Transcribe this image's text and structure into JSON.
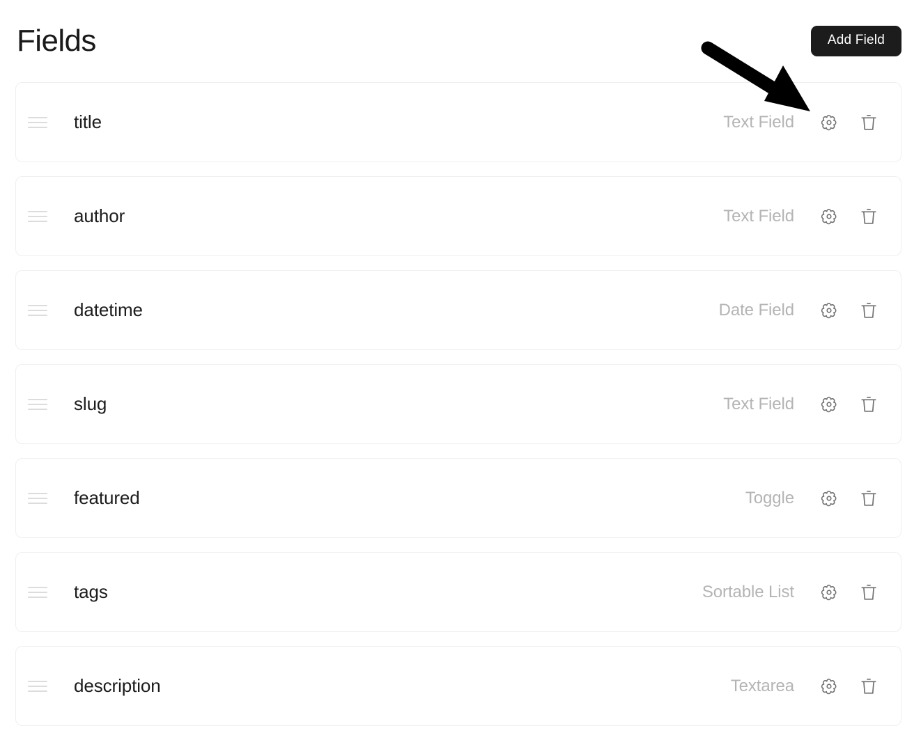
{
  "header": {
    "title": "Fields",
    "add_button_label": "Add Field"
  },
  "icons": {
    "drag_handle": "drag-handle-icon",
    "settings": "gear-icon",
    "delete": "trash-icon",
    "annotation": "arrow-icon"
  },
  "colors": {
    "button_background": "#1c1c1c",
    "button_text": "#ffffff",
    "row_border": "#efefef",
    "field_name_text": "#1c1c1c",
    "field_type_text": "#b4b4b4",
    "icon_stroke": "#6e6e6e",
    "drag_handle": "#dcdcdc",
    "annotation_arrow": "#000000",
    "page_background": "#ffffff"
  },
  "fields": [
    {
      "name": "title",
      "type": "Text Field"
    },
    {
      "name": "author",
      "type": "Text Field"
    },
    {
      "name": "datetime",
      "type": "Date Field"
    },
    {
      "name": "slug",
      "type": "Text Field"
    },
    {
      "name": "featured",
      "type": "Toggle"
    },
    {
      "name": "tags",
      "type": "Sortable List"
    },
    {
      "name": "description",
      "type": "Textarea"
    }
  ]
}
